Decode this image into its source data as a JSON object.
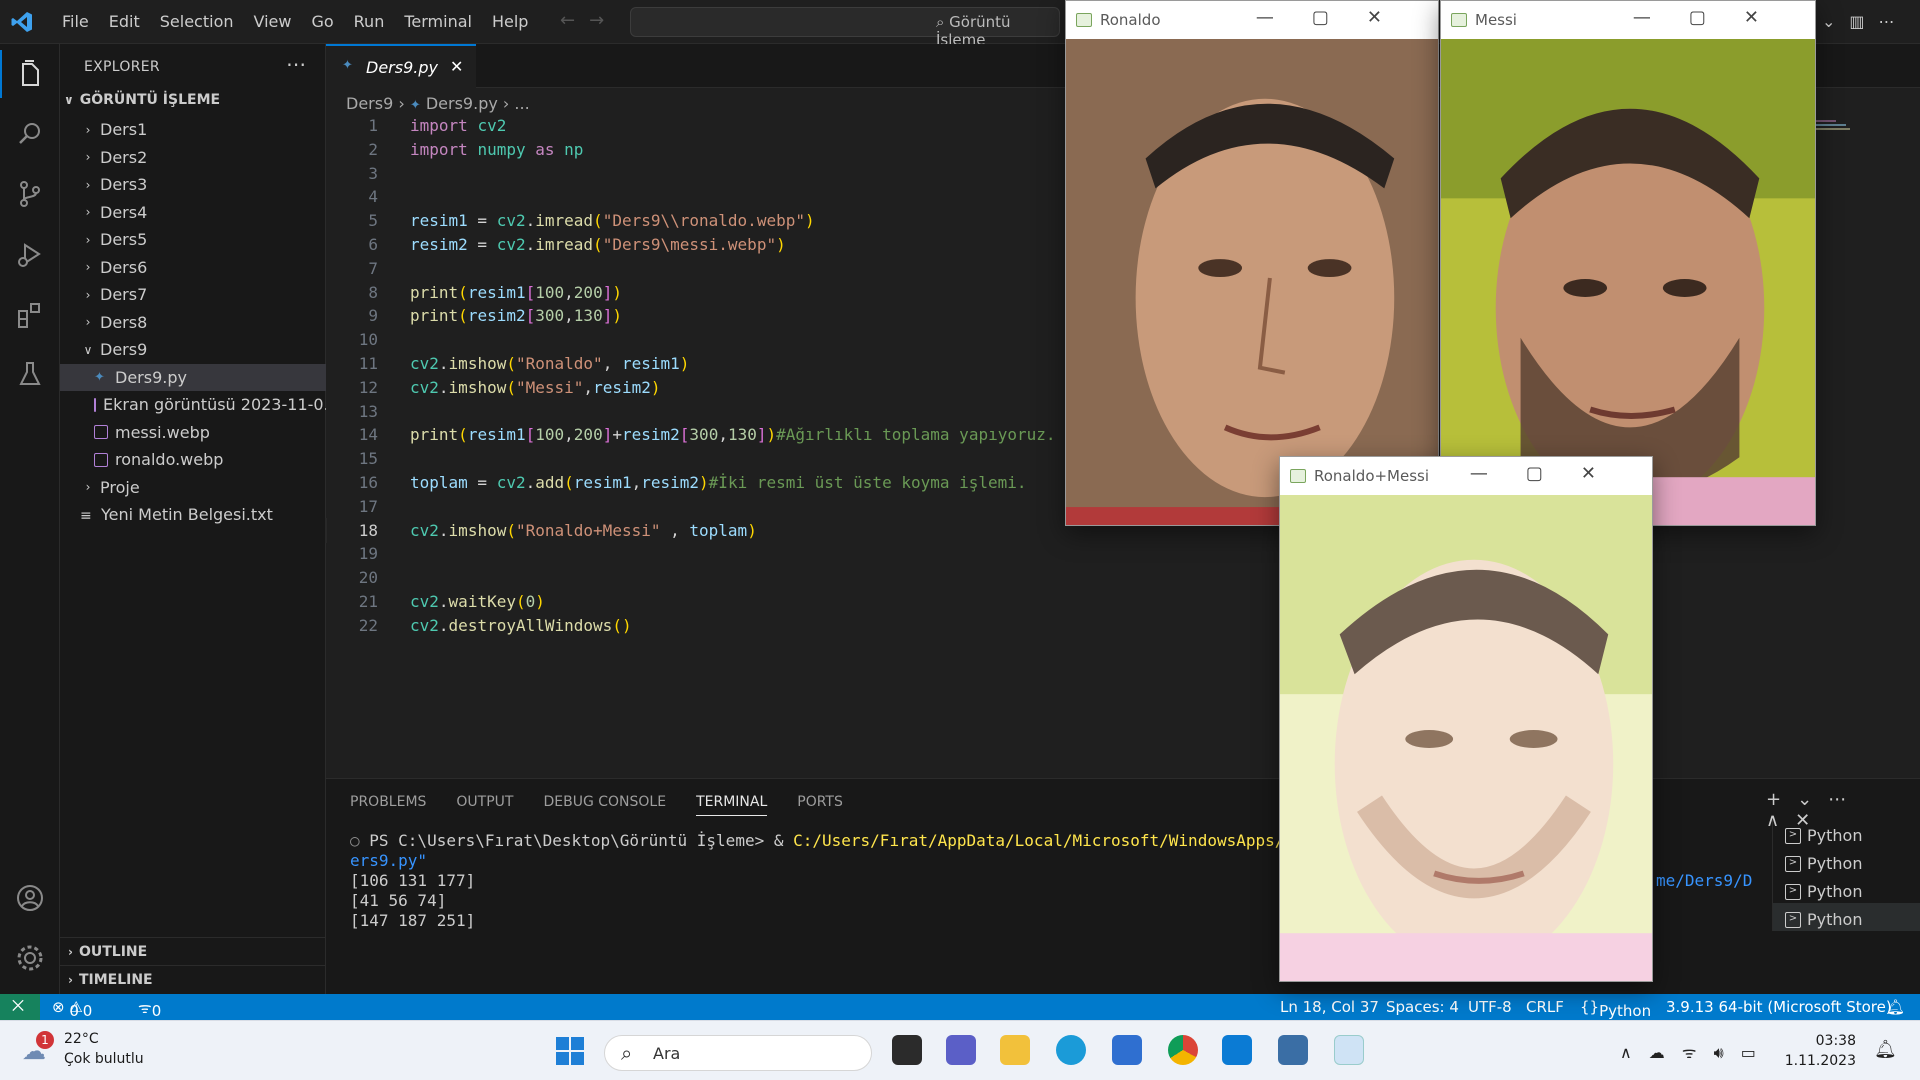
{
  "titlebar": {
    "menu": [
      "File",
      "Edit",
      "Selection",
      "View",
      "Go",
      "Run",
      "Terminal",
      "Help"
    ],
    "command_center": "Görüntü İşleme"
  },
  "sidebar": {
    "title": "EXPLORER",
    "section": "GÖRÜNTÜ İŞLEME",
    "items": [
      {
        "label": "Ders1",
        "kind": "folder"
      },
      {
        "label": "Ders2",
        "kind": "folder"
      },
      {
        "label": "Ders3",
        "kind": "folder"
      },
      {
        "label": "Ders4",
        "kind": "folder"
      },
      {
        "label": "Ders5",
        "kind": "folder"
      },
      {
        "label": "Ders6",
        "kind": "folder"
      },
      {
        "label": "Ders7",
        "kind": "folder"
      },
      {
        "label": "Ders8",
        "kind": "folder"
      },
      {
        "label": "Ders9",
        "kind": "folder-open"
      },
      {
        "label": "Ders9.py",
        "kind": "python"
      },
      {
        "label": "Ekran görüntüsü 2023-11-0...",
        "kind": "image"
      },
      {
        "label": "messi.webp",
        "kind": "image"
      },
      {
        "label": "ronaldo.webp",
        "kind": "image"
      },
      {
        "label": "Proje",
        "kind": "folder"
      },
      {
        "label": "Yeni Metin Belgesi.txt",
        "kind": "text"
      }
    ],
    "outline": "OUTLINE",
    "timeline": "TIMELINE"
  },
  "editor": {
    "tab": "Ders9.py",
    "breadcrumb": [
      "Ders9",
      "Ders9.py",
      "..."
    ],
    "lines": [
      "import cv2",
      "import numpy as np",
      "",
      "",
      "resim1 = cv2.imread(\"Ders9\\\\ronaldo.webp\")",
      "resim2 = cv2.imread(\"Ders9\\messi.webp\")",
      "",
      "print(resim1[100,200])",
      "print(resim2[300,130])",
      "",
      "cv2.imshow(\"Ronaldo\", resim1)",
      "cv2.imshow(\"Messi\",resim2)",
      "",
      "print(resim1[100,200]+resim2[300,130])#Ağırlıklı toplama yapıyoruz.",
      "",
      "toplam = cv2.add(resim1,resim2)#İki resmi üst üste koyma işlemi.",
      "",
      "cv2.imshow(\"Ronaldo+Messi\" , toplam)",
      "",
      "",
      "cv2.waitKey(0)",
      "cv2.destroyAllWindows()"
    ],
    "active_line": 18
  },
  "panel": {
    "tabs": [
      "PROBLEMS",
      "OUTPUT",
      "DEBUG CONSOLE",
      "TERMINAL",
      "PORTS"
    ],
    "active_tab": "TERMINAL",
    "prompt": "PS C:\\Users\\Fırat\\Desktop\\Görüntü İşleme> & ",
    "command": "C:/Users/Fırat/AppData/Local/Microsoft/WindowsApps/python3.",
    "command_tail": "me/Ders9/D",
    "continuation": "ers9.py\"",
    "output": [
      "[106 131 177]",
      "[41 56 74]",
      "[147 187 251]"
    ],
    "terminals": [
      "Python",
      "Python",
      "Python",
      "Python"
    ]
  },
  "statusbar": {
    "errors": "0",
    "warnings": "0",
    "ports": "0",
    "position": "Ln 18, Col 37",
    "spaces": "Spaces: 4",
    "encoding": "UTF-8",
    "eol": "CRLF",
    "language": "Python",
    "interpreter": "3.9.13 64-bit (Microsoft Store)"
  },
  "windows": {
    "ronaldo": "Ronaldo",
    "messi": "Messi",
    "sum": "Ronaldo+Messi"
  },
  "taskbar": {
    "temp": "22°C",
    "weather": "Çok bulutlu",
    "badge": "1",
    "search": "Ara",
    "time": "03:38",
    "date": "1.11.2023"
  },
  "colors": {
    "accent": "#0078d4",
    "statusbar": "#007acc",
    "remote": "#16825d"
  }
}
